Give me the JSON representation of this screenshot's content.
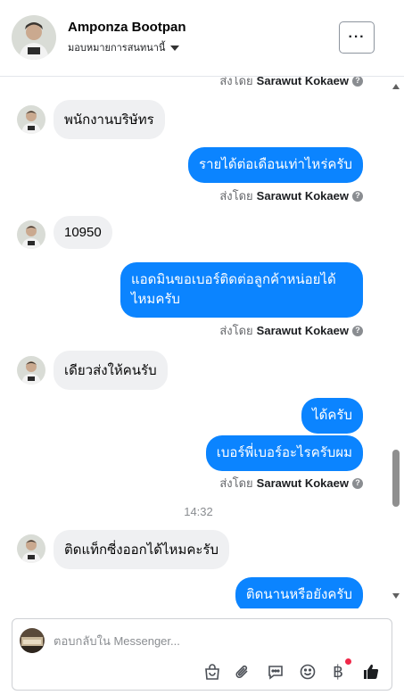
{
  "header": {
    "name": "Amponza Bootpan",
    "subtitle": "มอบหมายการสนทนานี้",
    "more_label": "···"
  },
  "thread": {
    "top_sent_by_prefix": "ส่งโดย",
    "top_sent_by_name": "Sarawut Kokaew",
    "messages": [
      {
        "side": "in",
        "text": "พนักงานบริษัทร"
      },
      {
        "side": "out",
        "text": "รายได้ต่อเดือนเท่าไหร่ครับ"
      },
      {
        "side": "in",
        "text": "10950"
      },
      {
        "side": "out",
        "text": "แอดมินขอเบอร์ติดต่อลูกค้าหน่อยได้ไหมครับ"
      },
      {
        "side": "in",
        "text": "เดียวส่งให้คนรับ"
      },
      {
        "side": "out",
        "text": "ได้ครับ"
      },
      {
        "side": "out",
        "text": "เบอร์พี่เบอร์อะไรครับผม"
      },
      {
        "side": "in",
        "text": "ติดแท็กซี่งออกได้ไหมคะรับ"
      },
      {
        "side": "out",
        "text": "ติดนานหรือยังครับ"
      }
    ],
    "sent_by_prefix": "ส่งโดย",
    "sent_by_name": "Sarawut Kokaew",
    "timestamp": "14:32"
  },
  "composer": {
    "placeholder": "ตอบกลับใน Messenger...",
    "tools": [
      "bag-icon",
      "paperclip-icon",
      "chat-bubble-icon",
      "emoji-icon",
      "baht-icon",
      "thumbs-up-icon"
    ],
    "baht_symbol": "฿"
  },
  "colors": {
    "outgoing_bubble": "#0b84ff",
    "incoming_bubble": "#eff0f2",
    "like_icon": "#1c1e21",
    "notification_dot": "#f02849"
  }
}
